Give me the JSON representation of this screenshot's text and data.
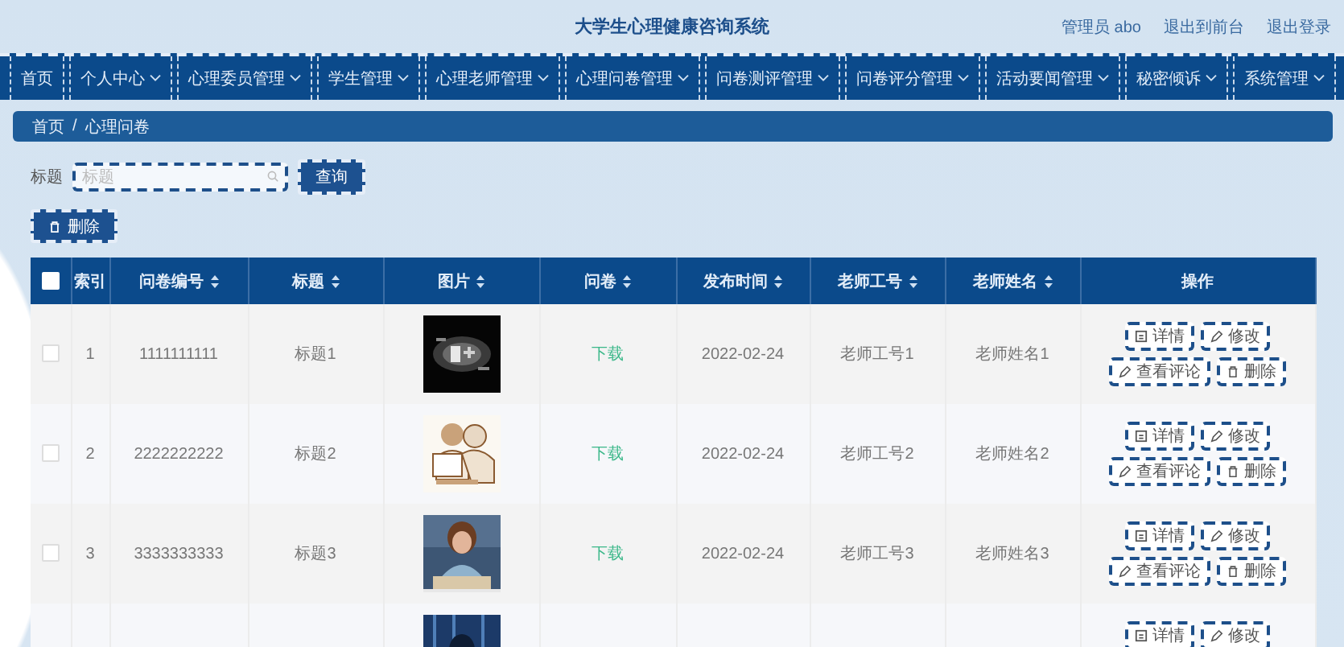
{
  "header": {
    "title": "大学生心理健康咨询系统",
    "links": [
      "管理员 abo",
      "退出到前台",
      "退出登录"
    ]
  },
  "nav": [
    {
      "label": "首页",
      "has_menu": false
    },
    {
      "label": "个人中心",
      "has_menu": true
    },
    {
      "label": "心理委员管理",
      "has_menu": true
    },
    {
      "label": "学生管理",
      "has_menu": true
    },
    {
      "label": "心理老师管理",
      "has_menu": true
    },
    {
      "label": "心理问卷管理",
      "has_menu": true
    },
    {
      "label": "问卷测评管理",
      "has_menu": true
    },
    {
      "label": "问卷评分管理",
      "has_menu": true
    },
    {
      "label": "活动要闻管理",
      "has_menu": true
    },
    {
      "label": "秘密倾诉",
      "has_menu": true
    },
    {
      "label": "系统管理",
      "has_menu": true
    }
  ],
  "breadcrumb": [
    "首页",
    "/",
    "心理问卷"
  ],
  "search": {
    "label": "标题",
    "placeholder": "标题",
    "button": "查询"
  },
  "delete_button": "删除",
  "table": {
    "select_all": {
      "checked": false
    },
    "columns": [
      {
        "label": "索引",
        "sortable": false
      },
      {
        "label": "问卷编号",
        "sortable": true
      },
      {
        "label": "标题",
        "sortable": true
      },
      {
        "label": "图片",
        "sortable": true
      },
      {
        "label": "问卷",
        "sortable": true
      },
      {
        "label": "发布时间",
        "sortable": true
      },
      {
        "label": "老师工号",
        "sortable": true
      },
      {
        "label": "老师姓名",
        "sortable": true
      },
      {
        "label": "操作",
        "sortable": false
      }
    ],
    "rows": [
      {
        "checked": false,
        "cells": [
          "1",
          "1111111111",
          "标题1"
        ],
        "picture": {
          "kind": "picture"
        },
        "file": "下载",
        "date": "2022-02-24",
        "teacher_id": "老师工号1",
        "teacher_name": "老师姓名1",
        "actions": [
          {
            "kind": "detail",
            "label": "详情"
          },
          {
            "kind": "edit",
            "label": "修改"
          },
          {
            "kind": "edit",
            "label": "查看评论"
          },
          {
            "kind": "delete",
            "label": "删除"
          }
        ]
      },
      {
        "checked": false,
        "cells": [
          "2",
          "2222222222",
          "标题2"
        ],
        "picture": {
          "kind": "picture"
        },
        "file": "下载",
        "date": "2022-02-24",
        "teacher_id": "老师工号2",
        "teacher_name": "老师姓名2",
        "actions": [
          {
            "kind": "detail",
            "label": "详情"
          },
          {
            "kind": "edit",
            "label": "修改"
          },
          {
            "kind": "edit",
            "label": "查看评论"
          },
          {
            "kind": "delete",
            "label": "删除"
          }
        ]
      },
      {
        "checked": false,
        "cells": [
          "3",
          "3333333333",
          "标题3"
        ],
        "picture": {
          "kind": "picture"
        },
        "file": "下载",
        "date": "2022-02-24",
        "teacher_id": "老师工号3",
        "teacher_name": "老师姓名3",
        "actions": [
          {
            "kind": "detail",
            "label": "详情"
          },
          {
            "kind": "edit",
            "label": "修改"
          },
          {
            "kind": "edit",
            "label": "查看评论"
          },
          {
            "kind": "delete",
            "label": "删除"
          }
        ]
      },
      {
        "picture": {
          "kind": "picture"
        },
        "actions": [
          {
            "kind": "detail",
            "label": "详情"
          },
          {
            "kind": "edit",
            "label": "修改"
          }
        ]
      }
    ]
  }
}
